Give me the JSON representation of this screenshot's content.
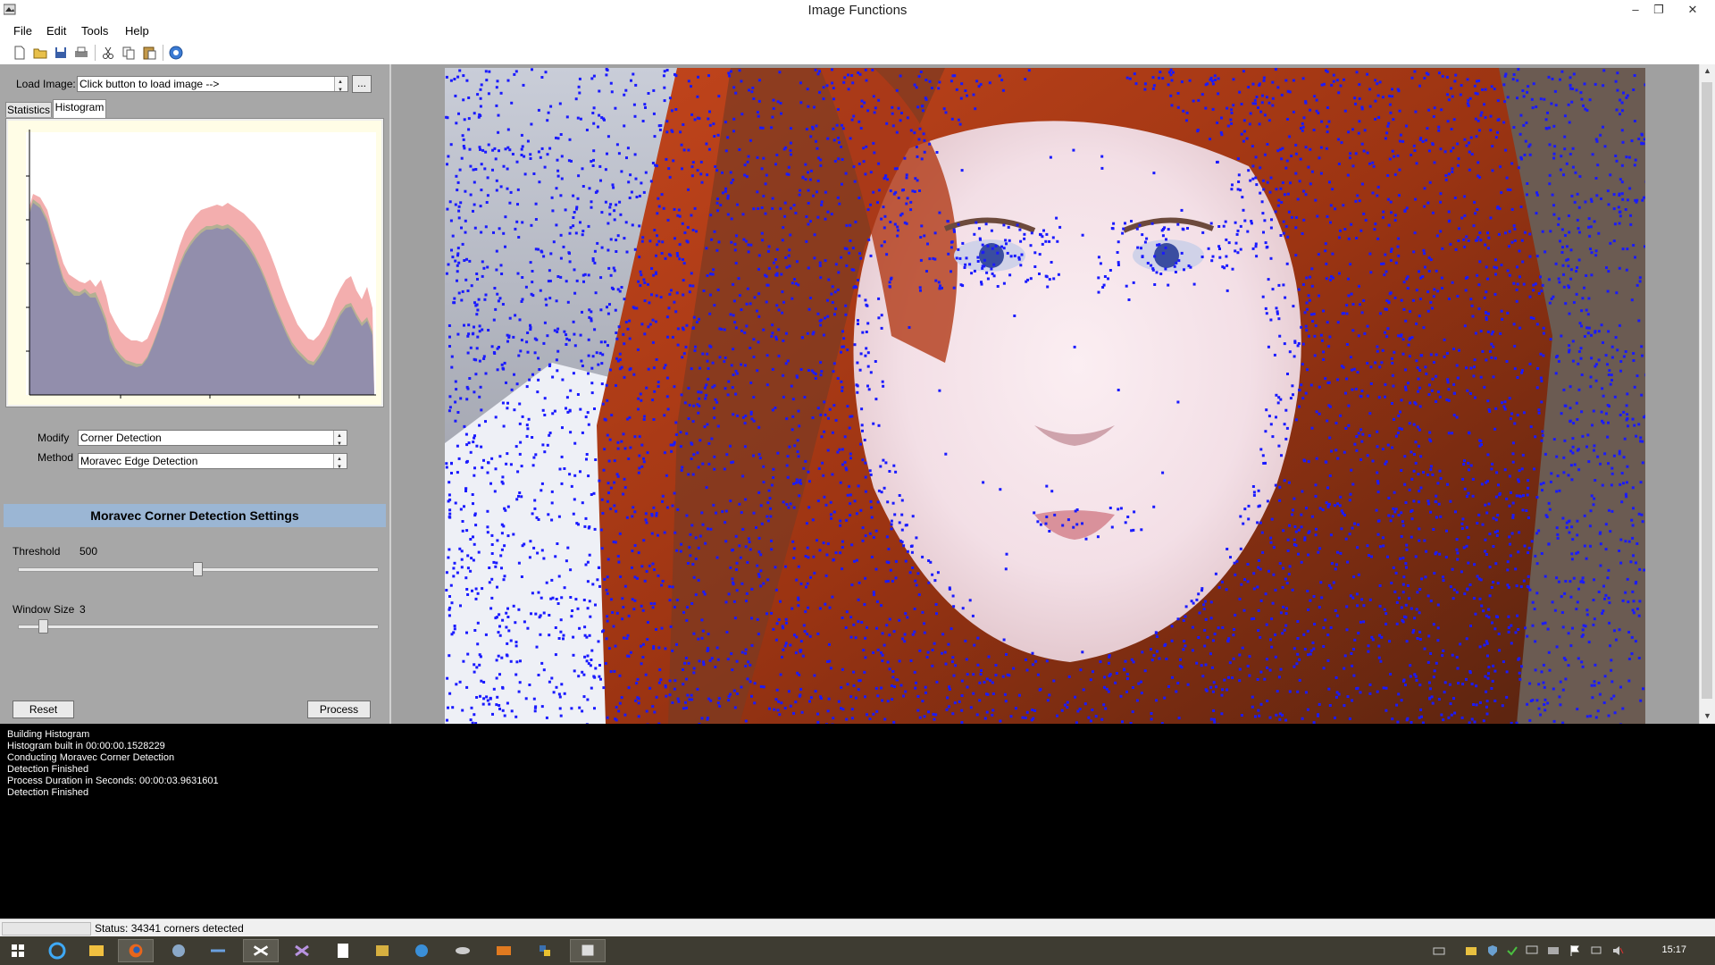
{
  "window": {
    "title": "Image Functions"
  },
  "menu": [
    "File",
    "Edit",
    "Tools",
    "Help"
  ],
  "toolbar_icons": [
    "new-icon",
    "open-icon",
    "save-icon",
    "print-icon",
    "cut-icon",
    "copy-icon",
    "paste-icon",
    "help-icon"
  ],
  "load": {
    "label": "Load Image:",
    "value": "Click button to load image -->",
    "browse_label": "..."
  },
  "tabs": [
    "Statistics",
    "Histogram"
  ],
  "active_tab": "Histogram",
  "modify": {
    "label": "Modify",
    "value": "Corner Detection"
  },
  "method": {
    "label": "Method",
    "value": "Moravec Edge Detection"
  },
  "settings": {
    "header": "Moravec Corner Detection Settings",
    "threshold": {
      "label": "Threshold",
      "value": "500",
      "level": 0.5
    },
    "window_size": {
      "label": "Window Size",
      "value": "3",
      "level": 0.07
    }
  },
  "buttons": {
    "reset": "Reset",
    "process": "Process"
  },
  "log_lines": [
    "Building Histogram",
    "Histogram built in 00:00:00.1528229",
    "Conducting Moravec Corner Detection",
    "Detection Finished",
    "Process Duration in Seconds: 00:00:03.9631601",
    "Detection Finished"
  ],
  "status": {
    "text": "Status:  34341 corners detected"
  },
  "clock": "15:17",
  "colors": {
    "panel": "#a7a7a7",
    "section_header": "#9bb6d4",
    "log_bg": "#000000",
    "taskbar": "#3e3c32",
    "corner_marks": "#1a1aff"
  }
}
